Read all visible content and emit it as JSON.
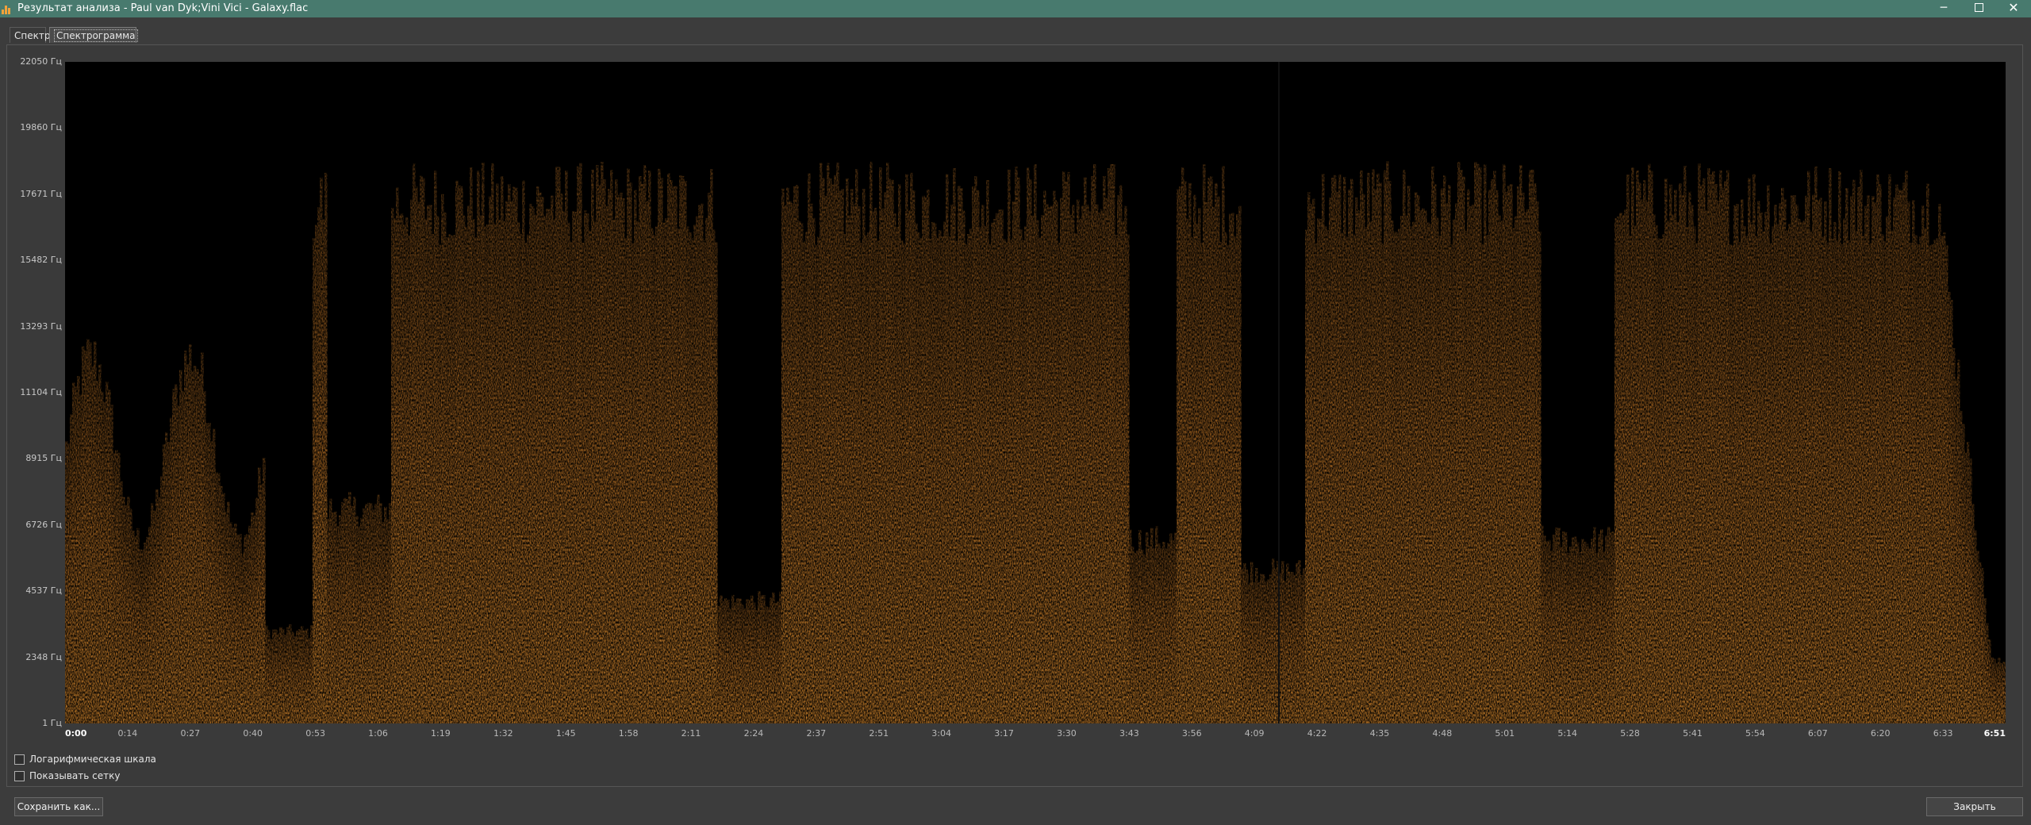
{
  "window": {
    "title": "Результат анализа - Paul van Dyk;Vini Vici - Galaxy.flac",
    "controls": [
      "minimize",
      "maximize",
      "close"
    ]
  },
  "tabs": [
    {
      "label": "Спектр",
      "active": false
    },
    {
      "label": "Спектрограмма",
      "active": true
    }
  ],
  "spectrogram": {
    "colormap": {
      "low": "#000000",
      "high": "#d98a2e"
    },
    "freq_labels": [
      "22050 Гц",
      "19860 Гц",
      "17671 Гц",
      "15482 Гц",
      "13293 Гц",
      "11104 Гц",
      "8915 Гц",
      "6726 Гц",
      "4537 Гц",
      "2348 Гц",
      "1 Гц"
    ],
    "time_labels": [
      "0:00",
      "0:14",
      "0:27",
      "0:40",
      "0:53",
      "1:06",
      "1:19",
      "1:32",
      "1:45",
      "1:58",
      "2:11",
      "2:24",
      "2:37",
      "2:51",
      "3:04",
      "3:17",
      "3:30",
      "3:43",
      "3:56",
      "4:09",
      "4:22",
      "4:35",
      "4:48",
      "5:01",
      "5:14",
      "5:28",
      "5:41",
      "5:54",
      "6:07",
      "6:20",
      "6:33",
      "6:51"
    ]
  },
  "options": {
    "log_scale_label": "Логарифмическая шкала",
    "log_scale_checked": false,
    "show_grid_label": "Показывать сетку",
    "show_grid_checked": false
  },
  "buttons": {
    "save_label": "Сохранить как...",
    "close_label": "Закрыть"
  }
}
